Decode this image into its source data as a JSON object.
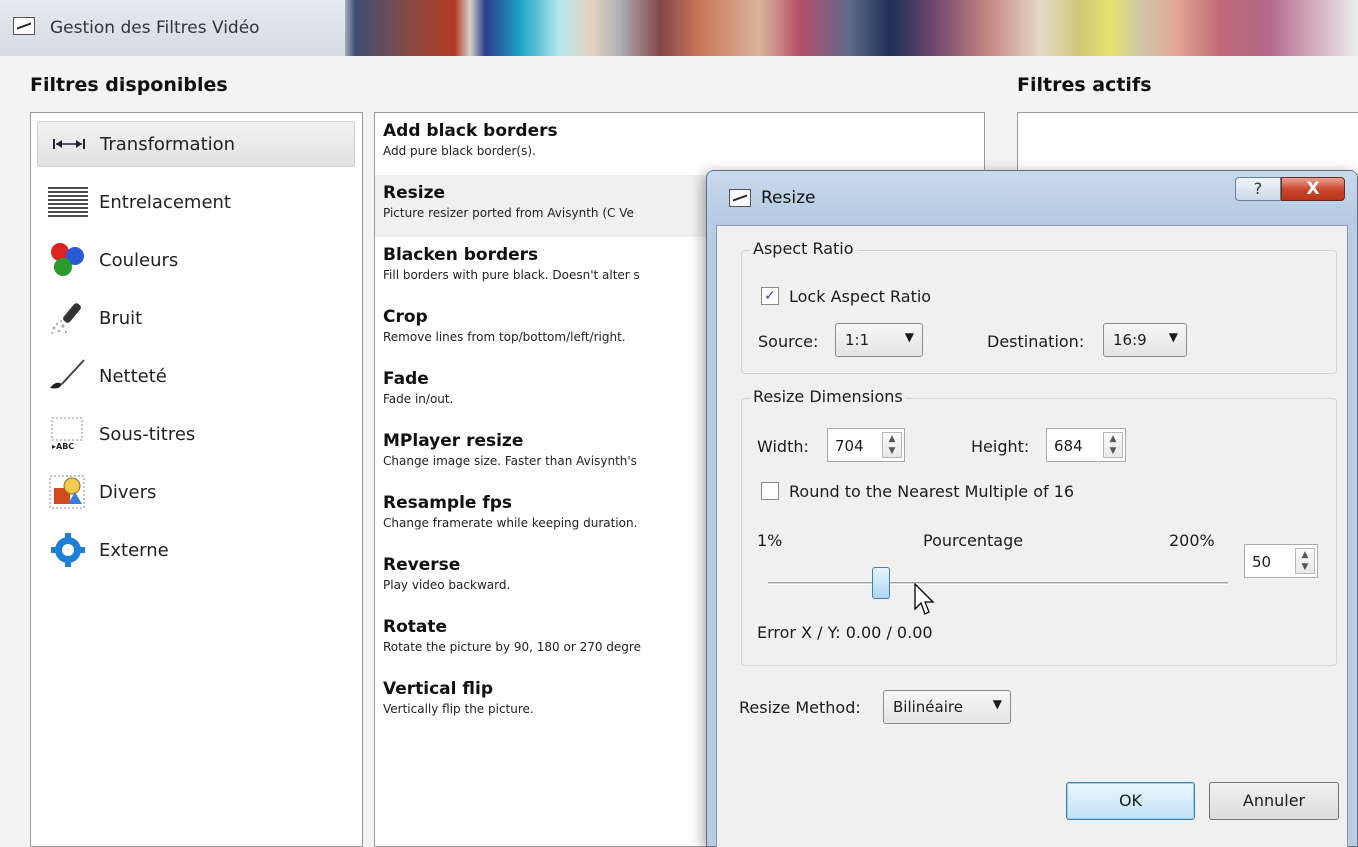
{
  "window": {
    "title": "Gestion des Filtres Vidéo"
  },
  "sections": {
    "available": "Filtres disponibles",
    "active": "Filtres actifs"
  },
  "categories": [
    {
      "label": "Transformation",
      "icon": "arrows-horizontal-icon",
      "selected": true
    },
    {
      "label": "Entrelacement",
      "icon": "interlace-lines-icon"
    },
    {
      "label": "Couleurs",
      "icon": "color-balls-icon"
    },
    {
      "label": "Bruit",
      "icon": "noise-brush-icon"
    },
    {
      "label": "Netteté",
      "icon": "sharpness-brush-icon"
    },
    {
      "label": "Sous-titres",
      "icon": "subtitles-icon"
    },
    {
      "label": "Divers",
      "icon": "misc-shapes-icon"
    },
    {
      "label": "Externe",
      "icon": "external-gear-icon"
    }
  ],
  "filters": [
    {
      "name": "Add black borders",
      "desc": "Add pure black border(s)."
    },
    {
      "name": "Resize",
      "desc": "Picture resizer ported from Avisynth (C Ve",
      "selected": true
    },
    {
      "name": "Blacken borders",
      "desc": "Fill borders with pure black. Doesn't alter s"
    },
    {
      "name": "Crop",
      "desc": "Remove lines from top/bottom/left/right."
    },
    {
      "name": "Fade",
      "desc": "Fade in/out."
    },
    {
      "name": "MPlayer resize",
      "desc": "Change image size. Faster than Avisynth's"
    },
    {
      "name": "Resample fps",
      "desc": "Change framerate while keeping duration."
    },
    {
      "name": "Reverse",
      "desc": "Play video backward."
    },
    {
      "name": "Rotate",
      "desc": "Rotate the picture by 90, 180 or 270 degre"
    },
    {
      "name": "Vertical flip",
      "desc": "Vertically flip the picture."
    }
  ],
  "dialog": {
    "title": "Resize",
    "help": "?",
    "close": "X",
    "aspect": {
      "group": "Aspect Ratio",
      "lock_label": "Lock Aspect Ratio",
      "lock_checked": true,
      "checkmark": "✓",
      "source_label": "Source:",
      "source_value": "1:1",
      "dest_label": "Destination:",
      "dest_value": "16:9"
    },
    "dims": {
      "group": "Resize Dimensions",
      "width_label": "Width:",
      "width_value": "704",
      "height_label": "Height:",
      "height_value": "684",
      "round_label": "Round to the Nearest Multiple of 16",
      "round_checked": false,
      "min_label": "1%",
      "pct_label": "Pourcentage",
      "max_label": "200%",
      "pct_value": "50",
      "slider_value": 50,
      "slider_min": 1,
      "slider_max": 200,
      "error_label": "Error X / Y:  0.00 / 0.00"
    },
    "method_label": "Resize Method:",
    "method_value": "Bilinéaire",
    "ok": "OK",
    "cancel": "Annuler"
  }
}
